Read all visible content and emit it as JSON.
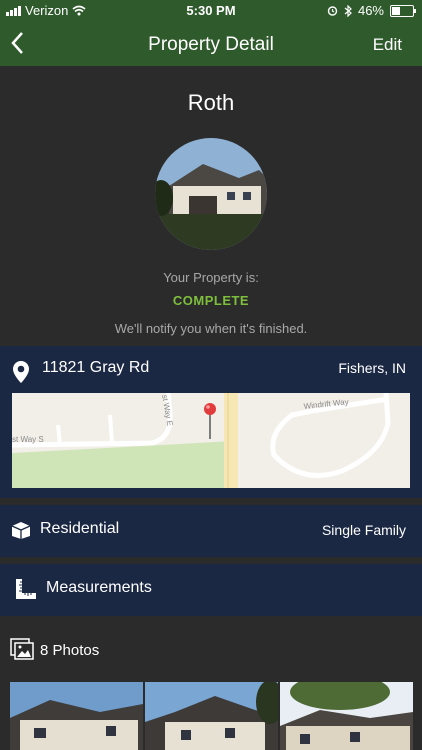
{
  "status_bar": {
    "carrier": "Verizon",
    "time": "5:30 PM",
    "battery_percent": "46%",
    "battery_level": 0.46
  },
  "nav": {
    "back_icon": "chevron-left-icon",
    "title": "Property Detail",
    "edit_label": "Edit"
  },
  "property": {
    "owner_name": "Roth",
    "status_label": "Your Property is:",
    "status_value": "COMPLETE",
    "status_color": "#7dbf3c",
    "notify_text": "We'll notify you when it's finished."
  },
  "address": {
    "street": "11821 Gray Rd",
    "city": "Fishers, IN",
    "map_labels": [
      "Windrift Way",
      "st Way E",
      "st Way S"
    ]
  },
  "type_row": {
    "label": "Residential",
    "value": "Single Family"
  },
  "measurements_row": {
    "label": "Measurements"
  },
  "photos": {
    "label": "8 Photos"
  },
  "colors": {
    "nav_green": "#2f5a2c",
    "panel_blue": "#1b2844",
    "background": "#2b2b2b"
  }
}
